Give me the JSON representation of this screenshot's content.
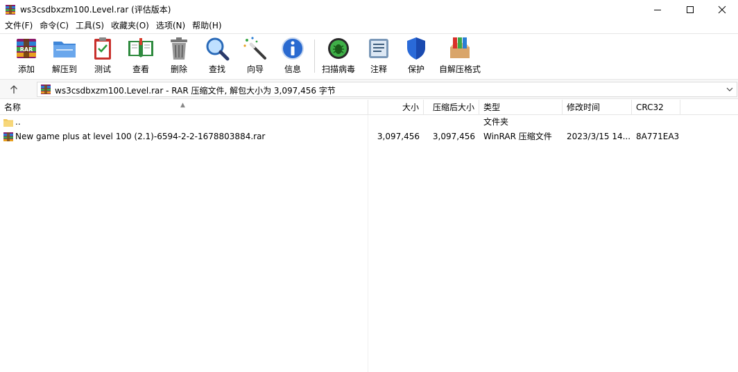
{
  "window": {
    "title": "ws3csdbxzm100.Level.rar (评估版本)"
  },
  "menu": [
    {
      "label": "文件(F)"
    },
    {
      "label": "命令(C)"
    },
    {
      "label": "工具(S)"
    },
    {
      "label": "收藏夹(O)"
    },
    {
      "label": "选项(N)"
    },
    {
      "label": "帮助(H)"
    }
  ],
  "toolbar": [
    {
      "label": "添加",
      "icon": "add-archive-icon"
    },
    {
      "label": "解压到",
      "icon": "extract-folder-icon"
    },
    {
      "label": "测试",
      "icon": "test-clipboard-icon"
    },
    {
      "label": "查看",
      "icon": "view-book-icon"
    },
    {
      "label": "删除",
      "icon": "trash-icon"
    },
    {
      "label": "查找",
      "icon": "magnifier-icon"
    },
    {
      "label": "向导",
      "icon": "wizard-wand-icon"
    },
    {
      "label": "信息",
      "icon": "info-icon"
    },
    {
      "label": "扫描病毒",
      "icon": "virus-scan-icon"
    },
    {
      "label": "注释",
      "icon": "comment-icon"
    },
    {
      "label": "保护",
      "icon": "shield-icon"
    },
    {
      "label": "自解压格式",
      "icon": "sfx-box-icon"
    }
  ],
  "address": {
    "text": "ws3csdbxzm100.Level.rar - RAR 压缩文件, 解包大小为 3,097,456 字节"
  },
  "columns": {
    "name": "名称",
    "size": "大小",
    "packed": "压缩后大小",
    "type": "类型",
    "modified": "修改时间",
    "crc": "CRC32"
  },
  "rows": [
    {
      "name": "..",
      "size": "",
      "packed": "",
      "type": "文件夹",
      "modified": "",
      "crc": "",
      "icon": "folder-icon"
    },
    {
      "name": "New game plus at level 100 (2.1)-6594-2-2-1678803884.rar",
      "size": "3,097,456",
      "packed": "3,097,456",
      "type": "WinRAR 压缩文件",
      "modified": "2023/3/15 14...",
      "crc": "8A771EA3",
      "icon": "rar-file-icon"
    }
  ]
}
